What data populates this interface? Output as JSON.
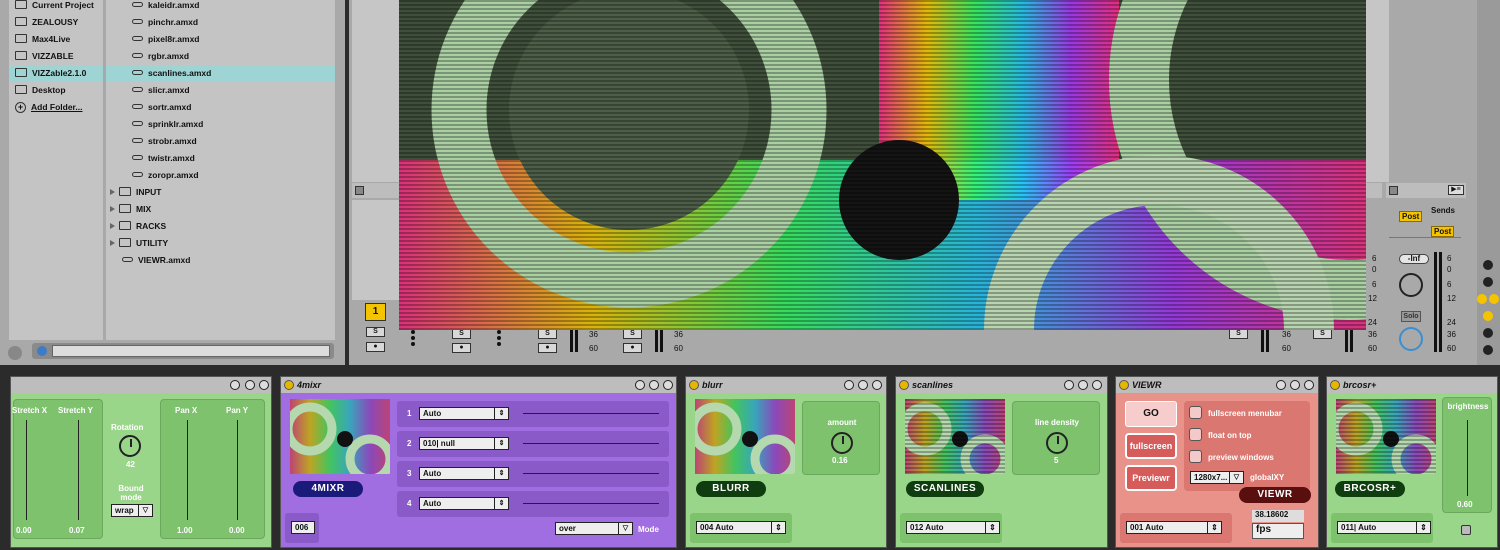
{
  "browser": {
    "places": [
      {
        "label": "Current Project",
        "icon": "project-icon"
      },
      {
        "label": "ZEALOUSY",
        "icon": "folder-icon"
      },
      {
        "label": "Max4Live",
        "icon": "folder-icon"
      },
      {
        "label": "VIZZABLE",
        "icon": "folder-icon"
      },
      {
        "label": "VIZZable2.1.0",
        "icon": "folder-icon",
        "selected": true
      },
      {
        "label": "Desktop",
        "icon": "folder-icon"
      },
      {
        "label": "Add Folder...",
        "icon": "plus-icon"
      }
    ],
    "files": [
      {
        "label": "kaleidr.amxd"
      },
      {
        "label": "pinchr.amxd"
      },
      {
        "label": "pixel8r.amxd"
      },
      {
        "label": "rgbr.amxd"
      },
      {
        "label": "scanlines.amxd",
        "selected": true
      },
      {
        "label": "slicr.amxd"
      },
      {
        "label": "sortr.amxd"
      },
      {
        "label": "sprinklr.amxd"
      },
      {
        "label": "strobr.amxd"
      },
      {
        "label": "twistr.amxd"
      },
      {
        "label": "zoropr.amxd"
      }
    ],
    "folders": [
      {
        "label": "INPUT"
      },
      {
        "label": "MIX"
      },
      {
        "label": "RACKS"
      },
      {
        "label": "UTILITY"
      }
    ],
    "last_file": "VIEWR.amxd",
    "search_value": ""
  },
  "session": {
    "track_number": "1",
    "solo": "S",
    "sends_label": "Sends",
    "post1": "Post",
    "post2": "Post",
    "volume": "-Inf",
    "solo_btn": "Solo",
    "meter_left": [
      "6",
      "0",
      "6",
      "12",
      "24",
      "36",
      "60"
    ],
    "meter_right": [
      "6",
      "0",
      "6",
      "12",
      "24",
      "36",
      "60"
    ],
    "mini_meters": [
      "36",
      "60",
      "36",
      "60",
      "36",
      "60"
    ],
    "accent": "#f5c400"
  },
  "devices": {
    "transform": {
      "stretch_x": "Stretch X",
      "stretch_y": "Stretch Y",
      "rotation": "Rotation",
      "rotation_val": "42",
      "bound_mode": "Bound mode",
      "bound_val": "wrap",
      "pan_x": "Pan X",
      "pan_y": "Pan Y",
      "sx_val": "0.00",
      "sy_val": "0.07",
      "px_val": "1.00",
      "py_val": "0.00"
    },
    "mixr": {
      "title": "4mixr",
      "badge": "4MIXR",
      "channel": "006",
      "rows": [
        {
          "n": "1",
          "v": "Auto"
        },
        {
          "n": "2",
          "v": "010| null"
        },
        {
          "n": "3",
          "v": "Auto"
        },
        {
          "n": "4",
          "v": "Auto"
        }
      ],
      "mode_val": "over",
      "mode_label": "Mode"
    },
    "blurr": {
      "title": "blurr",
      "badge": "BLURR",
      "param": "amount",
      "value": "0.16",
      "channel": "004",
      "mode": "Auto"
    },
    "scan": {
      "title": "scanlines",
      "badge": "SCANLINES",
      "param": "line density",
      "value": "5",
      "channel": "012",
      "mode": "Auto"
    },
    "viewr": {
      "title": "VIEWR",
      "go": "GO",
      "fullscreen": "fullscreen",
      "previewr": "Previewr",
      "opt1": "fullscreen menubar",
      "opt2": "float on top",
      "opt3": "preview windows",
      "res": "1280x7...",
      "global": "globalXY",
      "badge": "VIEWR",
      "channel": "001",
      "mode": "Auto",
      "fps_val": "38.18602",
      "fps": "fps"
    },
    "brcosr": {
      "title": "brcosr+",
      "badge": "BRCOSR+",
      "param": "brightness",
      "value": "0.60",
      "channel": "011|",
      "mode": "Auto"
    }
  }
}
